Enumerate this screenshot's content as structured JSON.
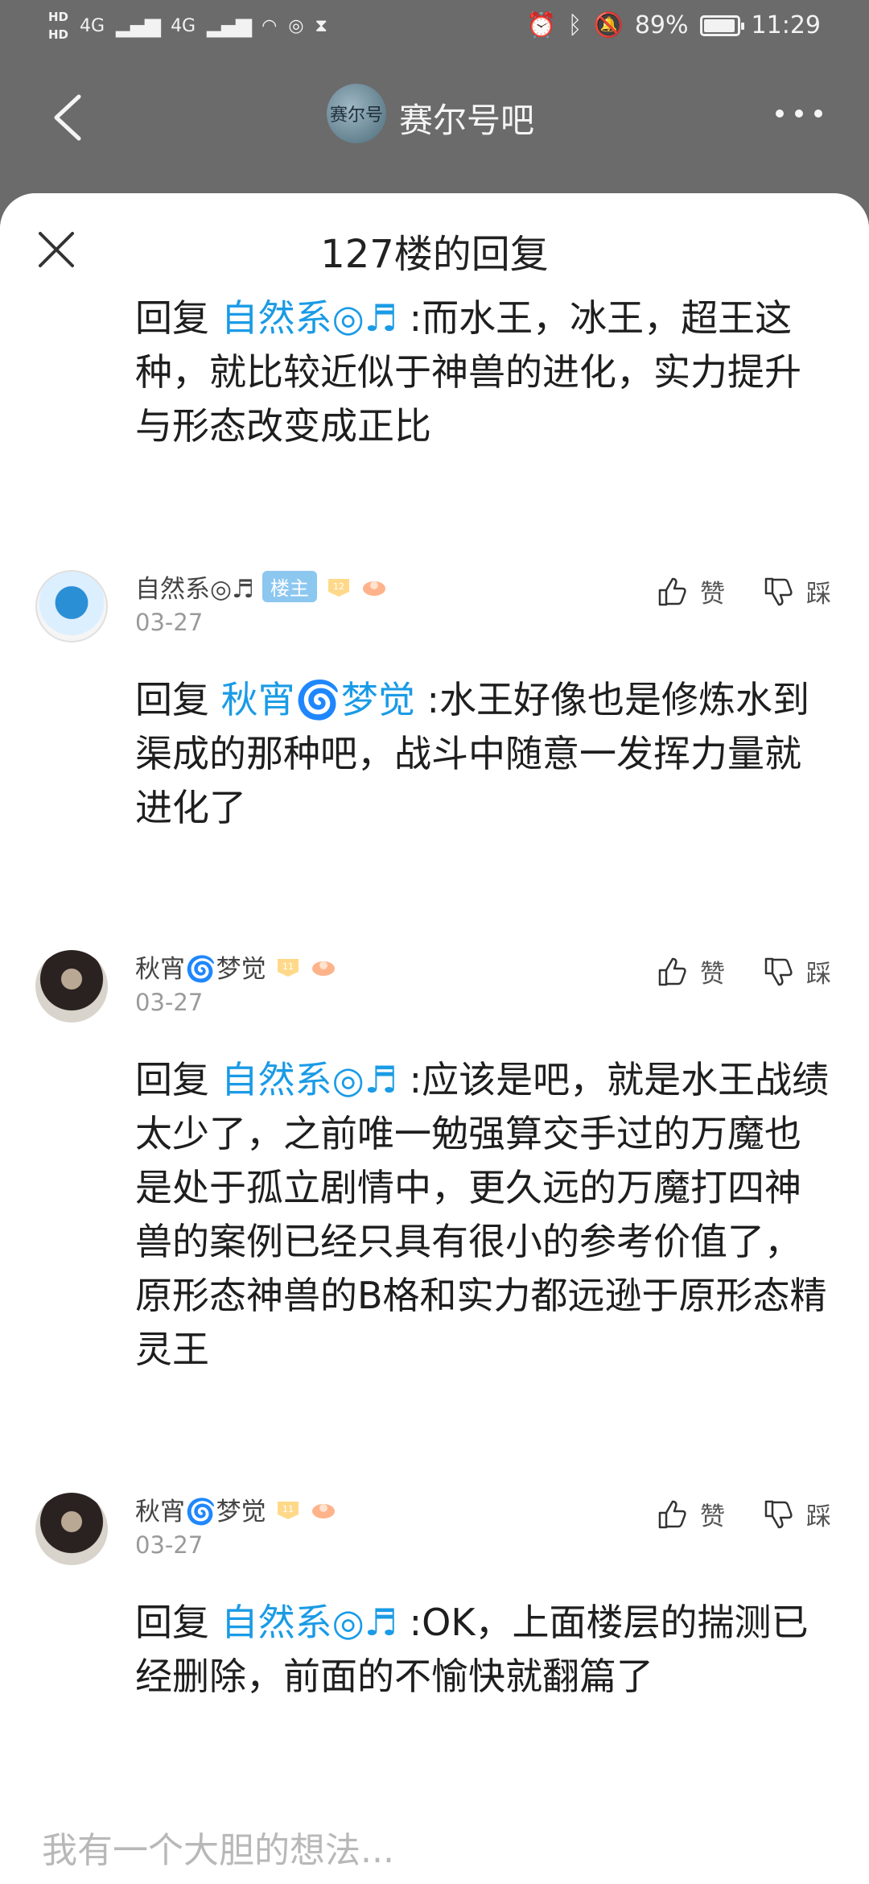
{
  "status": {
    "battery": "89%",
    "time": "11:29",
    "hd1": "HD",
    "hd2": "HD",
    "net1": "4G",
    "net2": "4G"
  },
  "nav": {
    "forum_avatar_text": "赛尔号",
    "forum_title": "赛尔号吧"
  },
  "sheet": {
    "title": "127楼的回复"
  },
  "replies": [
    {
      "prefix": "回复",
      "target": "自然系◎♬",
      "text": ":而水王，冰王，超王这种，就比较近似于神兽的进化，实力提升与形态改变成正比"
    },
    {
      "user": "自然系◎♬",
      "owner_badge": "楼主",
      "level": "12",
      "date": "03-27",
      "like": "赞",
      "dislike": "踩",
      "prefix": "回复",
      "target": "秋宵🌀梦觉",
      "text": ":水王好像也是修炼水到渠成的那种吧，战斗中随意一发挥力量就进化了"
    },
    {
      "user": "秋宵🌀梦觉",
      "level": "11",
      "date": "03-27",
      "like": "赞",
      "dislike": "踩",
      "prefix": "回复",
      "target": "自然系◎♬",
      "text": ":应该是吧，就是水王战绩太少了，之前唯一勉强算交手过的万魔也是处于孤立剧情中，更久远的万魔打四神兽的案例已经只具有很小的参考价值了，原形态神兽的B格和实力都远逊于原形态精灵王"
    },
    {
      "user": "秋宵🌀梦觉",
      "level": "11",
      "date": "03-27",
      "like": "赞",
      "dislike": "踩",
      "prefix": "回复",
      "target": "自然系◎♬",
      "text": ":OK，上面楼层的揣测已经删除，前面的不愉快就翻篇了"
    }
  ],
  "input": {
    "placeholder": "我有一个大胆的想法..."
  }
}
